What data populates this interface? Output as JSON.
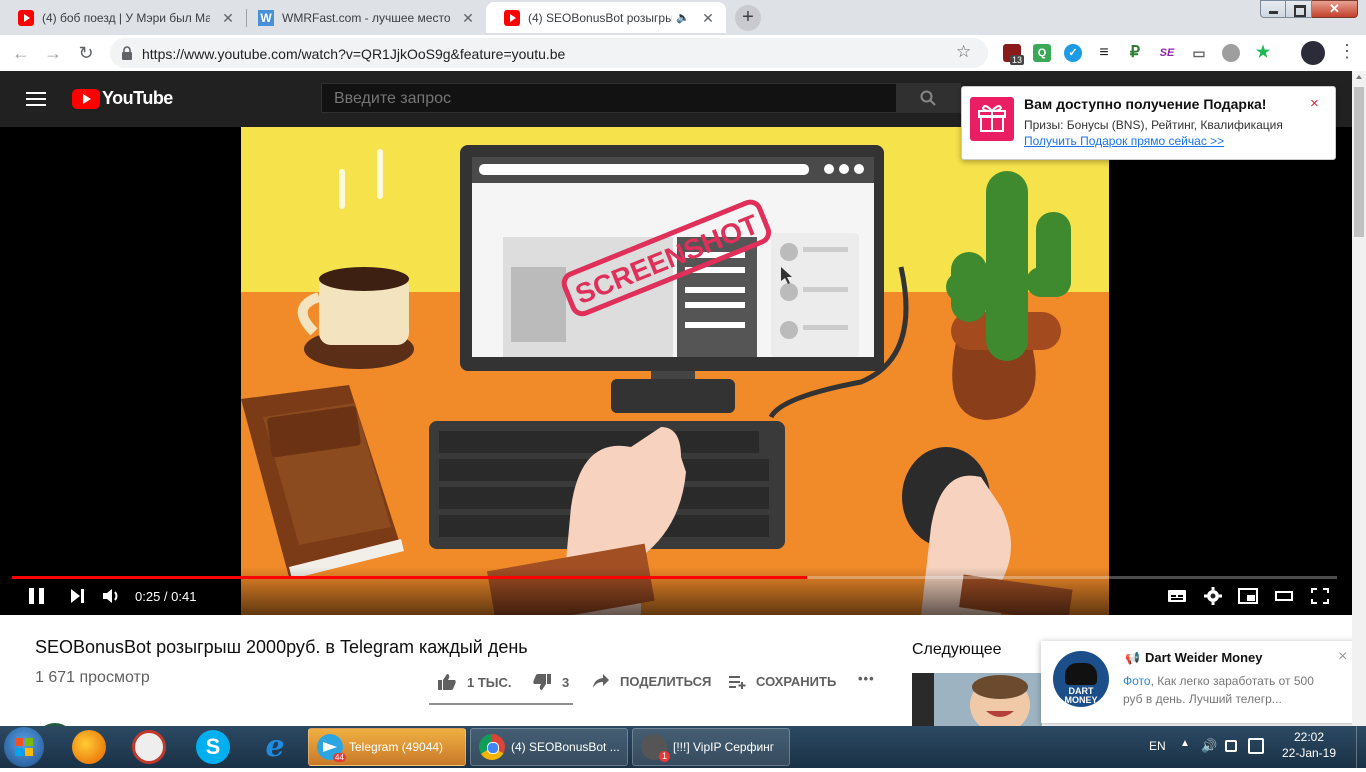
{
  "browser": {
    "tabs": [
      {
        "title": "(4) боб поезд | У Мэри был Ма",
        "favicon": "youtube-icon",
        "active": false
      },
      {
        "title": "WMRFast.com - лучшее место д",
        "favicon": "wmrfast-icon",
        "active": false
      },
      {
        "title": "(4) SEOBonusBot розыгрыш",
        "favicon": "youtube-icon",
        "active": true
      }
    ],
    "new_tab_symbol": "+",
    "url": "https://www.youtube.com/watch?v=QR1JjkOoS9g&feature=youtu.be",
    "extension_badge": "13",
    "extension_letter_q": "Q",
    "extension_letter_p": "₽",
    "extension_letter_se": "SE"
  },
  "youtube": {
    "logo_text": "YouTube",
    "search_placeholder": "Введите запрос",
    "player": {
      "time_current": "0:25",
      "time_separator": " / ",
      "time_total": "0:41",
      "progress": 0.6,
      "buffered": 1.0,
      "screenshot_stamp": "SCREENSHOT"
    },
    "video": {
      "title": "SEOBonusBot розыгрыш 2000руб. в Telegram каждый день",
      "views": "1 671 просмотр",
      "likes": "1 ТЫС.",
      "dislikes": "3",
      "share_label": "ПОДЕЛИТЬСЯ",
      "save_label": "СОХРАНИТЬ",
      "more_label": "•••"
    },
    "up_next_label": "Следующее"
  },
  "gift_popup": {
    "title": "Вам доступно получение Подарка!",
    "body": "Призы: Бонусы (BNS), Рейтинг, Квалификация",
    "link": "Получить Подарок прямо сейчас >>",
    "close": "×"
  },
  "dart_popup": {
    "channel": "Dart Weider Money",
    "logo_text": "DART MONEY",
    "message_prefix": "Фото",
    "message_rest": ", Как легко заработать от 500 руб в день. Лучший телегр...",
    "close": "×"
  },
  "taskbar": {
    "buttons": [
      {
        "label": "Telegram (49044)",
        "badge": "44",
        "active": true
      },
      {
        "label": "(4) SEOBonusBot ...",
        "badge": "",
        "active": false
      },
      {
        "label": "[!!!] VipIP Серфинг",
        "badge": "1",
        "active": false
      }
    ],
    "language": "EN",
    "time": "22:02",
    "date": "22-Jan-19"
  },
  "colors": {
    "youtube_red": "#ff0000",
    "header_dark": "#212121",
    "link_blue": "#1a73e8",
    "gift_pink": "#e91e63"
  }
}
